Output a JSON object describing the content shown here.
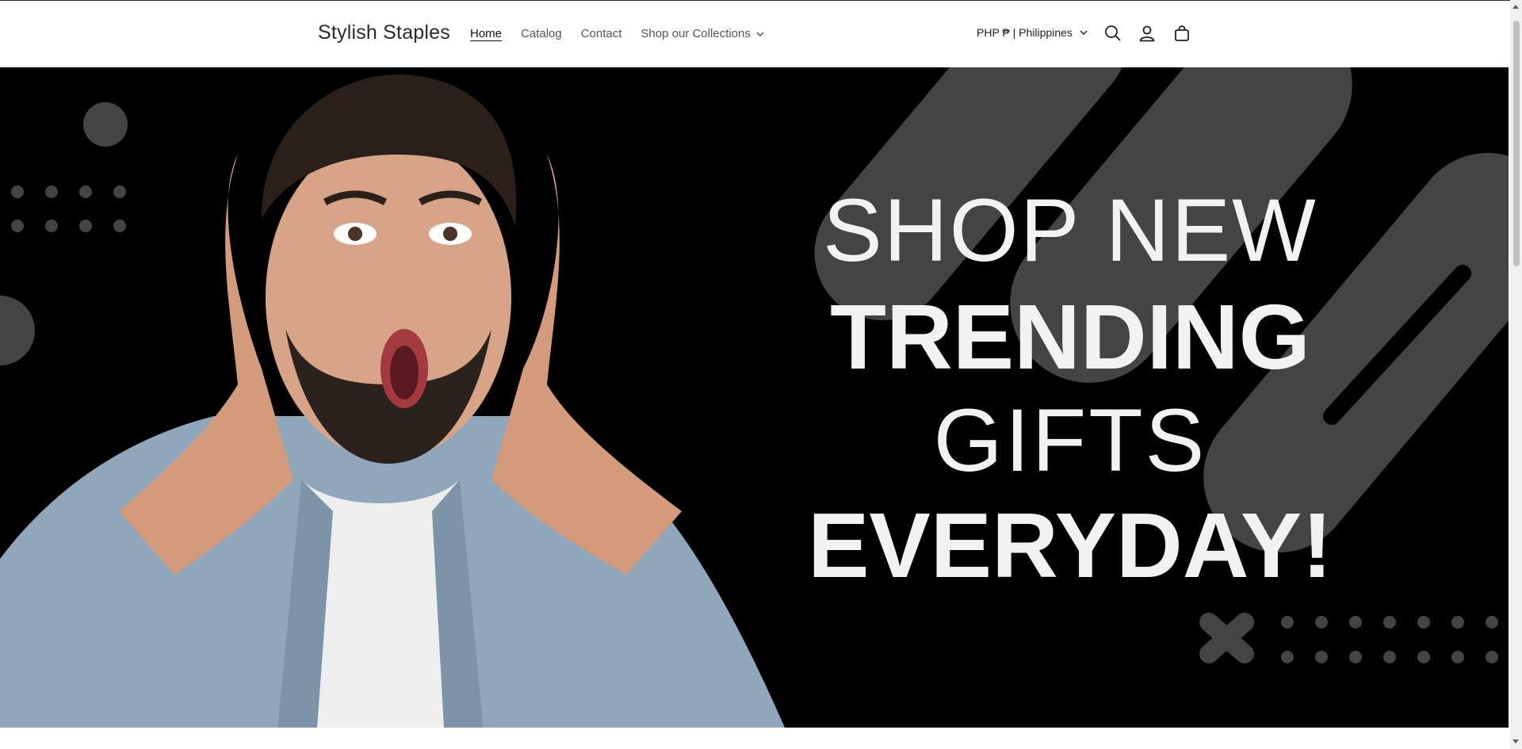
{
  "header": {
    "brand": "Stylish Staples",
    "nav": [
      {
        "label": "Home",
        "active": true
      },
      {
        "label": "Catalog"
      },
      {
        "label": "Contact"
      },
      {
        "label": "Shop our Collections",
        "has_dropdown": true
      }
    ],
    "currency": "PHP ₱ | Philippines",
    "icons": [
      "search-icon",
      "account-icon",
      "cart-icon"
    ]
  },
  "hero": {
    "line1": "SHOP NEW",
    "line2": "TRENDING",
    "line3": "GIFTS",
    "line4": "EVERYDAY!",
    "image_subject": "surprised-man-photo"
  },
  "colors": {
    "hero_background": "#000000",
    "hero_text": "#f2f2f2",
    "decor_gray": "#444444"
  }
}
